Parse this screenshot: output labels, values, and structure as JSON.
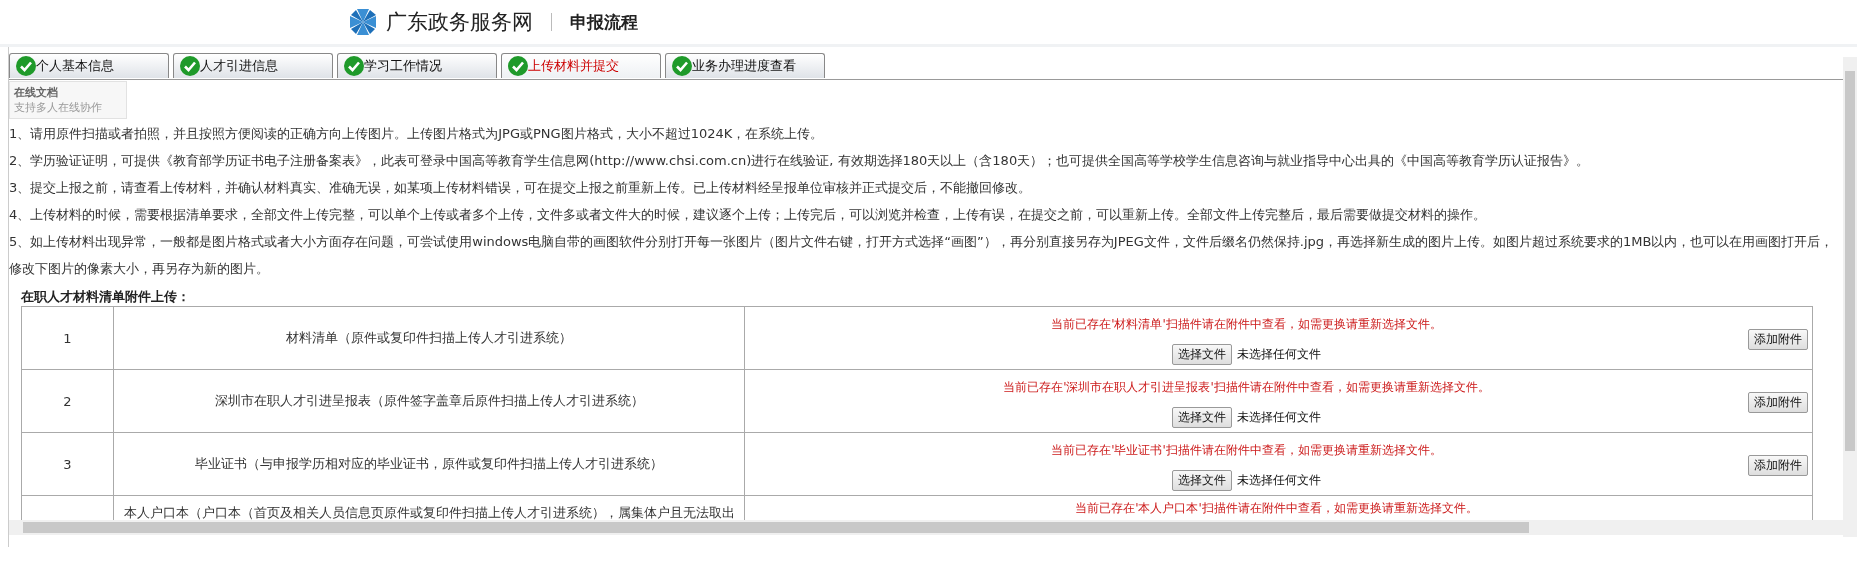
{
  "header": {
    "site_name": "广东政务服务网",
    "page_title": "申报流程"
  },
  "tabs": [
    {
      "label": "个人基本信息",
      "selected": false,
      "completed": true
    },
    {
      "label": "人才引进信息",
      "selected": false,
      "completed": true
    },
    {
      "label": "学习工作情况",
      "selected": false,
      "completed": true
    },
    {
      "label": "上传材料并提交",
      "selected": true,
      "completed": true
    },
    {
      "label": "业务办理进度查看",
      "selected": false,
      "completed": true
    }
  ],
  "tooltip": {
    "title": "在线文档",
    "subtitle": "支持多人在线协作"
  },
  "instructions": [
    "1、请用原件扫描或者拍照，并且按照方便阅读的正确方向上传图片。上传图片格式为JPG或PNG图片格式，大小不超过1024K，在系统上传。",
    "2、学历验证证明，可提供《教育部学历证书电子注册备案表》，此表可登录中国高等教育学生信息网(http://www.chsi.com.cn)进行在线验证, 有效期选择180天以上（含180天）；也可提供全国高等学校学生信息咨询与就业指导中心出具的《中国高等教育学历认证报告》。",
    "3、提交上报之前，请查看上传材料，并确认材料真实、准确无误，如某项上传材料错误，可在提交上报之前重新上传。已上传材料经呈报单位审核并正式提交后，不能撤回修改。",
    "4、上传材料的时候，需要根据清单要求，全部文件上传完整，可以单个上传或者多个上传，文件多或者文件大的时候，建议逐个上传；上传完后，可以浏览并检查，上传有误，在提交之前，可以重新上传。全部文件上传完整后，最后需要做提交材料的操作。",
    "5、如上传材料出现异常，一般都是图片格式或者大小方面存在问题，可尝试使用windows电脑自带的画图软件分别打开每一张图片（图片文件右键，打开方式选择“画图”），再分别直接另存为JPEG文件，文件后缀名仍然保持.jpg，再选择新生成的图片上传。如图片超过系统要求的1MB以内，也可以在用画图打开后，修改下图片的像素大小，再另存为新的图片。"
  ],
  "upload_section": {
    "title": "在职人才材料清单附件上传：",
    "rows": [
      {
        "number": "1",
        "material": "材料清单（原件或复印件扫描上传人才引进系统）",
        "notice": "当前已存在'材料清单'扫描件请在附件中查看，如需更换请重新选择文件。",
        "choose_button": "选择文件",
        "file_status": "未选择任何文件",
        "add_button": "添加附件"
      },
      {
        "number": "2",
        "material": "深圳市在职人才引进呈报表（原件签字盖章后原件扫描上传人才引进系统）",
        "notice": "当前已存在'深圳市在职人才引进呈报表'扫描件请在附件中查看，如需更换请重新选择文件。",
        "choose_button": "选择文件",
        "file_status": "未选择任何文件",
        "add_button": "添加附件"
      },
      {
        "number": "3",
        "material": "毕业证书（与申报学历相对应的毕业证书，原件或复印件扫描上传人才引进系统）",
        "notice": "当前已存在'毕业证书'扫描件请在附件中查看，如需更换请重新选择文件。",
        "choose_button": "选择文件",
        "file_status": "未选择任何文件",
        "add_button": "添加附件"
      },
      {
        "material": "本人户口本（户口本（首页及相关人员信息页原件或复印件扫描上传人才引进系统），属集体户且无法取出",
        "notice": "当前已存在'本人户口本'扫描件请在附件中查看，如需更换请重新选择文件。"
      }
    ]
  }
}
